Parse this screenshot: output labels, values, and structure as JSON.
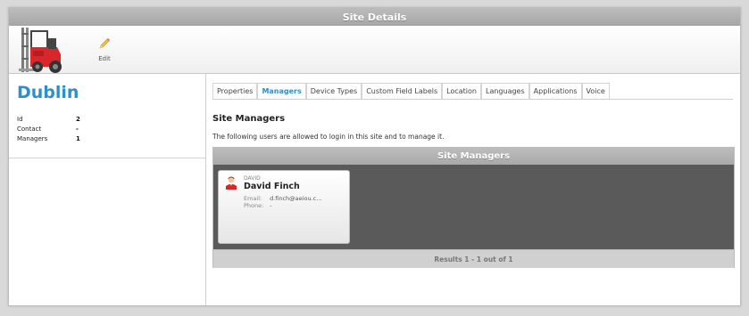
{
  "window": {
    "title": "Site Details"
  },
  "toolbar": {
    "edit_label": "Edit"
  },
  "site": {
    "name": "Dublin",
    "properties": [
      {
        "key": "Id",
        "value": "2"
      },
      {
        "key": "Contact",
        "value": "-"
      },
      {
        "key": "Managers",
        "value": "1"
      }
    ]
  },
  "tabs": [
    {
      "label": "Properties",
      "active": false
    },
    {
      "label": "Managers",
      "active": true
    },
    {
      "label": "Device Types",
      "active": false
    },
    {
      "label": "Custom Field Labels",
      "active": false
    },
    {
      "label": "Location",
      "active": false
    },
    {
      "label": "Languages",
      "active": false
    },
    {
      "label": "Applications",
      "active": false
    },
    {
      "label": "Voice",
      "active": false
    }
  ],
  "main": {
    "section_title": "Site Managers",
    "description": "The following users are allowed to login in this site and to manage it."
  },
  "grid": {
    "title": "Site Managers",
    "footer": "Results 1 - 1 out of 1",
    "users": [
      {
        "caption": "DAVID",
        "name": "David Finch",
        "email_label": "Email:",
        "email": "d.finch@aeiou.c...",
        "phone_label": "Phone:",
        "phone": "-"
      }
    ]
  },
  "colors": {
    "accent": "#2f8fc9",
    "header_gray": "#a9a9a9",
    "grid_bg": "#5a5a5a"
  }
}
